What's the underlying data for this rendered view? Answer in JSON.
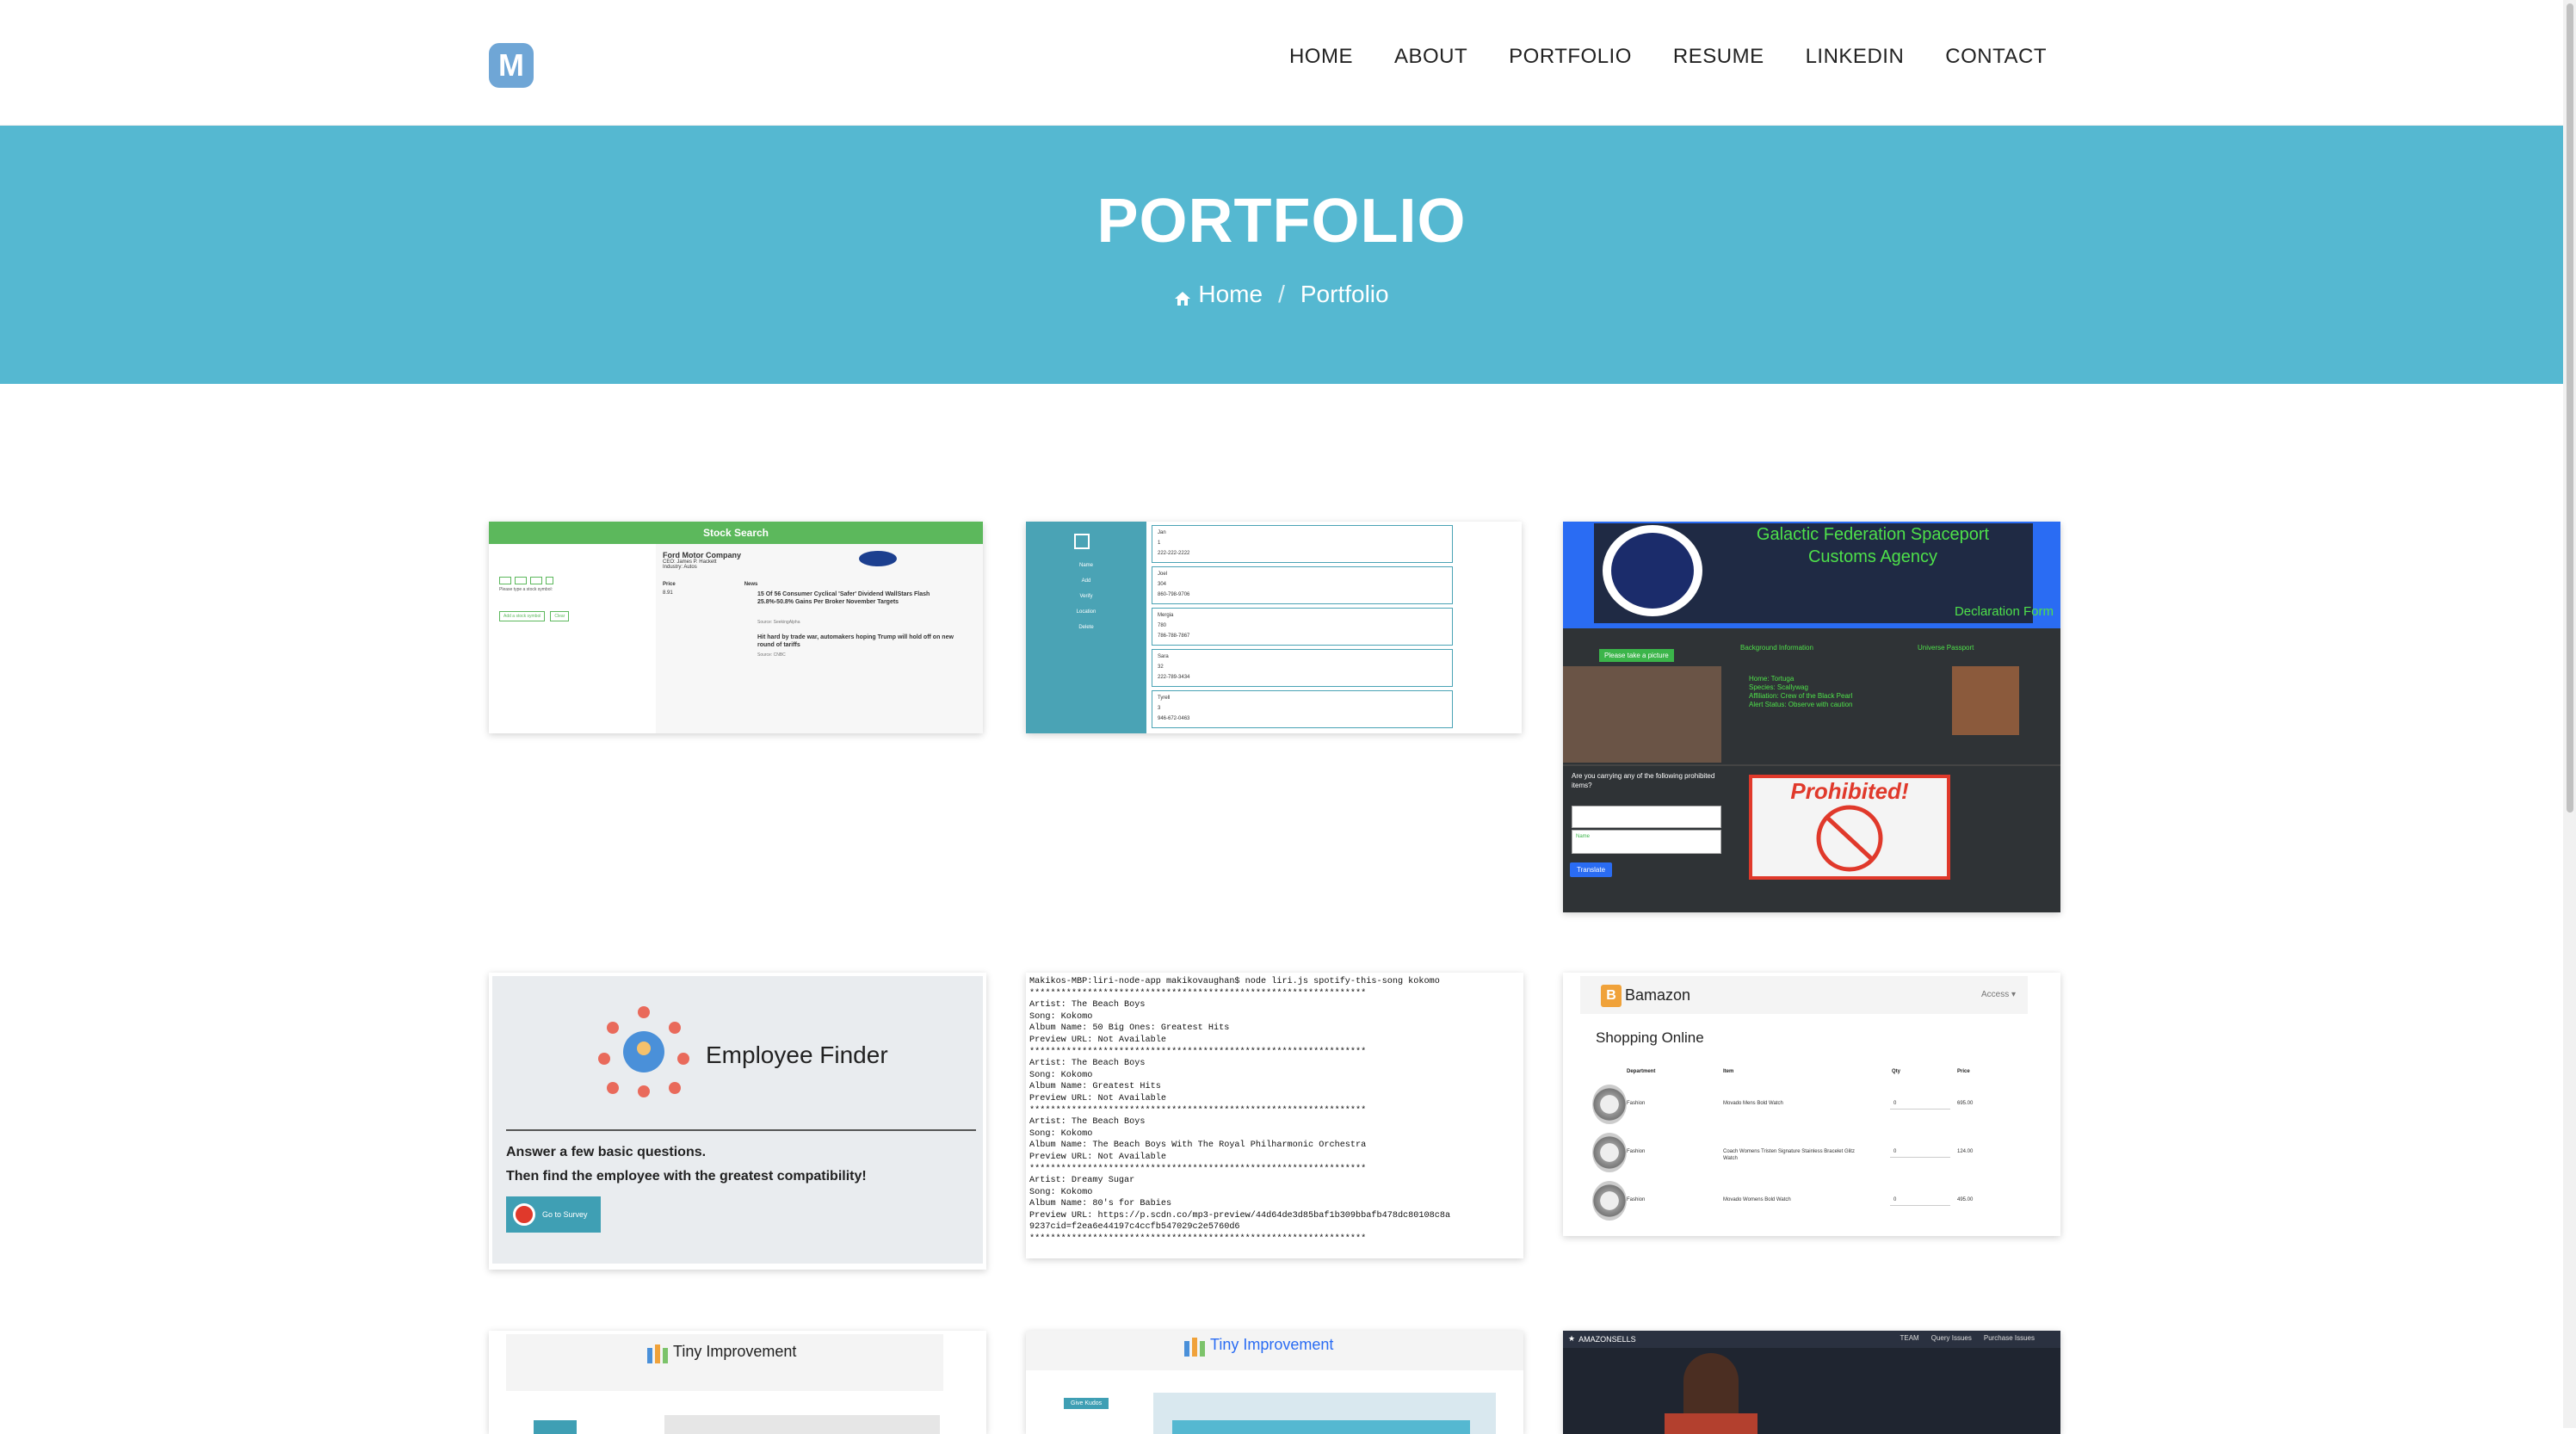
{
  "header": {
    "logo_letter": "M",
    "nav": [
      "HOME",
      "ABOUT",
      "PORTFOLIO",
      "RESUME",
      "LINKEDIN",
      "CONTACT"
    ]
  },
  "hero": {
    "title": "PORTFOLIO",
    "breadcrumb_home": "Home",
    "breadcrumb_sep": "/",
    "breadcrumb_current": "Portfolio"
  },
  "projects": {
    "stock": {
      "title": "Stock Search",
      "company": "Ford Motor Company",
      "ceo": "CEO: James P. Hackett",
      "industry": "Industry: Autos",
      "col_price": "Price",
      "col_news": "News",
      "price_val": "8.91",
      "headline1": "15 Of 56 Consumer Cyclical 'Safer' Dividend WallStars Flash 25.8%-50.8% Gains Per Broker November Targets",
      "headline2": "Hit hard by trade war, automakers hoping Trump will hold off on new round of tariffs",
      "source": "Source: CNBC",
      "source2": "Source: SeekingAlpha",
      "prompt": "Please type a stock symbol:",
      "add_btn": "Add a stock symbol",
      "clear_btn": "Clear"
    },
    "contacts": {
      "side_items": [
        "Name",
        "Add",
        "Verify",
        "Location",
        "Delete"
      ],
      "entries": [
        {
          "name": "Jan",
          "num": "1",
          "phone": "222-222-2222"
        },
        {
          "name": "Joel",
          "num": "304",
          "phone": "860-798-9706"
        },
        {
          "name": "Mergia",
          "num": "780",
          "phone": "786-788-7867"
        },
        {
          "name": "Sara",
          "num": "32",
          "phone": "222-789-3434"
        },
        {
          "name": "Tyrell",
          "num": "3",
          "phone": "946-672-0463"
        }
      ]
    },
    "galactic": {
      "title_line1": "Galactic Federation Spaceport",
      "title_line2": "Customs Agency",
      "declaration": "Declaration Form",
      "take_picture": "Please take a picture",
      "background_info": "Background Information",
      "universe_passport": "Universe Passport",
      "info_lines": [
        "Home: Tortuga",
        "Species: Scallywag",
        "Affiliation: Crew of the Black Pearl",
        "Alert Status: Observe with caution"
      ],
      "question": "Are you carrying any of the following prohibited items?",
      "input_placeholder": "Name",
      "translate_btn": "Translate",
      "prohibited": "Prohibited!"
    },
    "employee": {
      "title": "Employee Finder",
      "line1": "Answer a few basic questions.",
      "line2": "Then find the employee with the greatest compatibility!",
      "button": "Go to Survey"
    },
    "liri": {
      "lines": [
        "Makikos-MBP:liri-node-app makikovaughan$ node liri.js spotify-this-song kokomo",
        "****************************************************************",
        "Artist: The Beach Boys",
        "Song: Kokomo",
        "Album Name: 50 Big Ones: Greatest Hits",
        "Preview URL: Not Available",
        "****************************************************************",
        "Artist: The Beach Boys",
        "Song: Kokomo",
        "Album Name: Greatest Hits",
        "Preview URL: Not Available",
        "****************************************************************",
        "Artist: The Beach Boys",
        "Song: Kokomo",
        "Album Name: The Beach Boys With The Royal Philharmonic Orchestra",
        "Preview URL: Not Available",
        "****************************************************************",
        "Artist: Dreamy Sugar",
        "Song: Kokomo",
        "Album Name: 80's for Babies",
        "Preview URL: https://p.scdn.co/mp3-preview/44d64de3d85baf1b309bbafb478dc80108c8a",
        "9237cid=f2ea6e44197c4ccfb547029c2e5760d6",
        "****************************************************************"
      ]
    },
    "bamazon": {
      "brand": "Bamazon",
      "access": "Access ▾",
      "heading": "Shopping Online",
      "cols": [
        "Department",
        "Item",
        "Qty",
        "Price"
      ],
      "rows": [
        {
          "dept": "Fashion",
          "item": "Movado Mens Bold Watch",
          "qty": "0",
          "price": "695.00"
        },
        {
          "dept": "Fashion",
          "item": "Coach Womens Tristen Signature Stainless Bracelet Glitz Watch",
          "qty": "0",
          "price": "124.00"
        },
        {
          "dept": "Fashion",
          "item": "Movado Womens Bold Watch",
          "qty": "0",
          "price": "495.00"
        }
      ]
    },
    "tiny1": {
      "title": "Tiny Improvement"
    },
    "tiny2": {
      "title": "Tiny Improvement",
      "button": "Give Kudos"
    },
    "amazonsells": {
      "brand": "AMAZONSELLS",
      "nav": [
        "TEAM",
        "Query Issues",
        "Purchase Issues"
      ]
    }
  },
  "colors": {
    "hero_bg": "#55b8d1",
    "stock_green": "#5cb85c",
    "contacts_teal": "#4aa3b5",
    "galactic_blue": "#2a6cf3",
    "galactic_green": "#4ee04a",
    "teal_button": "#3f9fb4"
  }
}
